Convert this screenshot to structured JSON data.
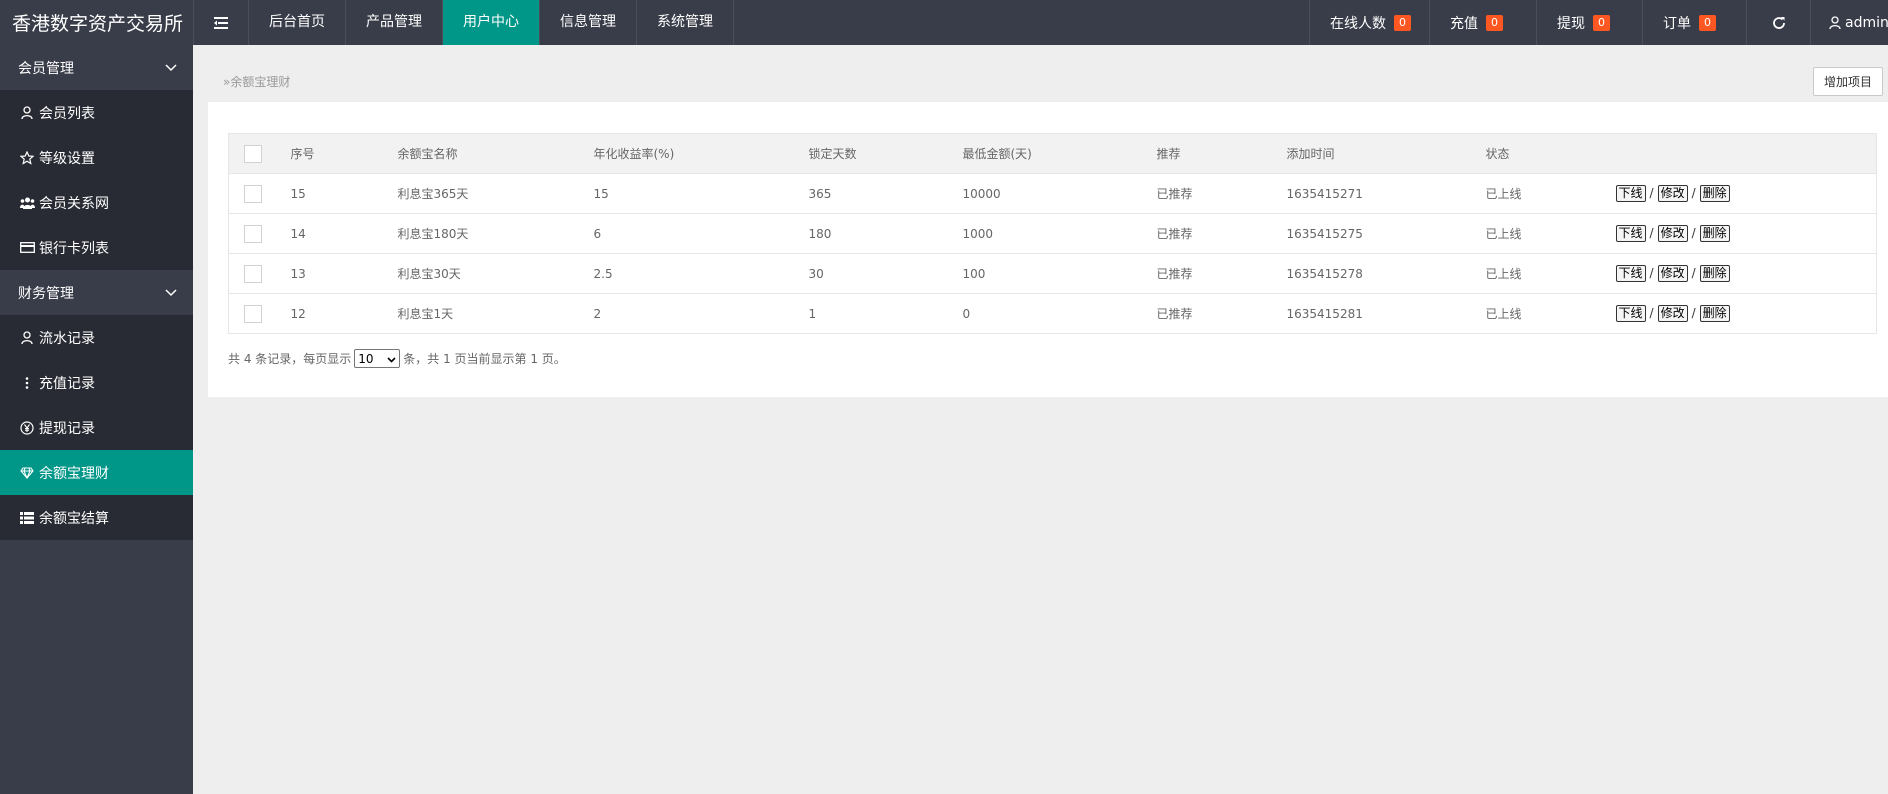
{
  "app": {
    "brand": "香港数字资产交易所"
  },
  "topnav": {
    "items": [
      {
        "label": "后台首页"
      },
      {
        "label": "产品管理"
      },
      {
        "label": "用户中心"
      },
      {
        "label": "信息管理"
      },
      {
        "label": "系统管理"
      }
    ],
    "active_index": 2,
    "right": {
      "online": {
        "label": "在线人数",
        "count": "0"
      },
      "recharge": {
        "label": "充值",
        "count": "0"
      },
      "withdraw": {
        "label": "提现",
        "count": "0"
      },
      "orders": {
        "label": "订单",
        "count": "0"
      },
      "user": "admin"
    }
  },
  "sidebar": {
    "groups": [
      {
        "label": "会员管理",
        "items": [
          {
            "label": "会员列表",
            "icon": "user-icon"
          },
          {
            "label": "等级设置",
            "icon": "star-icon"
          },
          {
            "label": "会员关系网",
            "icon": "users-icon"
          },
          {
            "label": "银行卡列表",
            "icon": "credit-card-icon"
          }
        ]
      },
      {
        "label": "财务管理",
        "items": [
          {
            "label": "流水记录",
            "icon": "user-icon"
          },
          {
            "label": "充值记录",
            "icon": "more-vertical-icon"
          },
          {
            "label": "提现记录",
            "icon": "yen-icon"
          },
          {
            "label": "余额宝理财",
            "icon": "diamond-icon"
          },
          {
            "label": "余额宝结算",
            "icon": "list-icon"
          }
        ]
      }
    ],
    "active_item": "余额宝理财"
  },
  "main": {
    "breadcrumb": "余额宝理财",
    "add_button": "增加项目",
    "table": {
      "headers": [
        "序号",
        "余额宝名称",
        "年化收益率(%)",
        "锁定天数",
        "最低金额(天)",
        "推荐",
        "添加时间",
        "状态"
      ],
      "rows": [
        {
          "id": "15",
          "name": "利息宝365天",
          "rate": "15",
          "days": "365",
          "min": "10000",
          "recommend": "已推荐",
          "time": "1635415271",
          "status": "已上线"
        },
        {
          "id": "14",
          "name": "利息宝180天",
          "rate": "6",
          "days": "180",
          "min": "1000",
          "recommend": "已推荐",
          "time": "1635415275",
          "status": "已上线"
        },
        {
          "id": "13",
          "name": "利息宝30天",
          "rate": "2.5",
          "days": "30",
          "min": "100",
          "recommend": "已推荐",
          "time": "1635415278",
          "status": "已上线"
        },
        {
          "id": "12",
          "name": "利息宝1天",
          "rate": "2",
          "days": "1",
          "min": "0",
          "recommend": "已推荐",
          "time": "1635415281",
          "status": "已上线"
        }
      ],
      "actions": {
        "offline": "下线",
        "edit": "修改",
        "delete": "删除",
        "sep": "/"
      }
    },
    "pager": {
      "prefix": "共 4 条记录，每页显示",
      "page_size": "10",
      "suffix": "条，共 1 页当前显示第 1 页。"
    }
  },
  "colors": {
    "topbar": "#393d49",
    "accent": "#009688",
    "badge": "#ff5722",
    "submenu": "#282b33"
  }
}
